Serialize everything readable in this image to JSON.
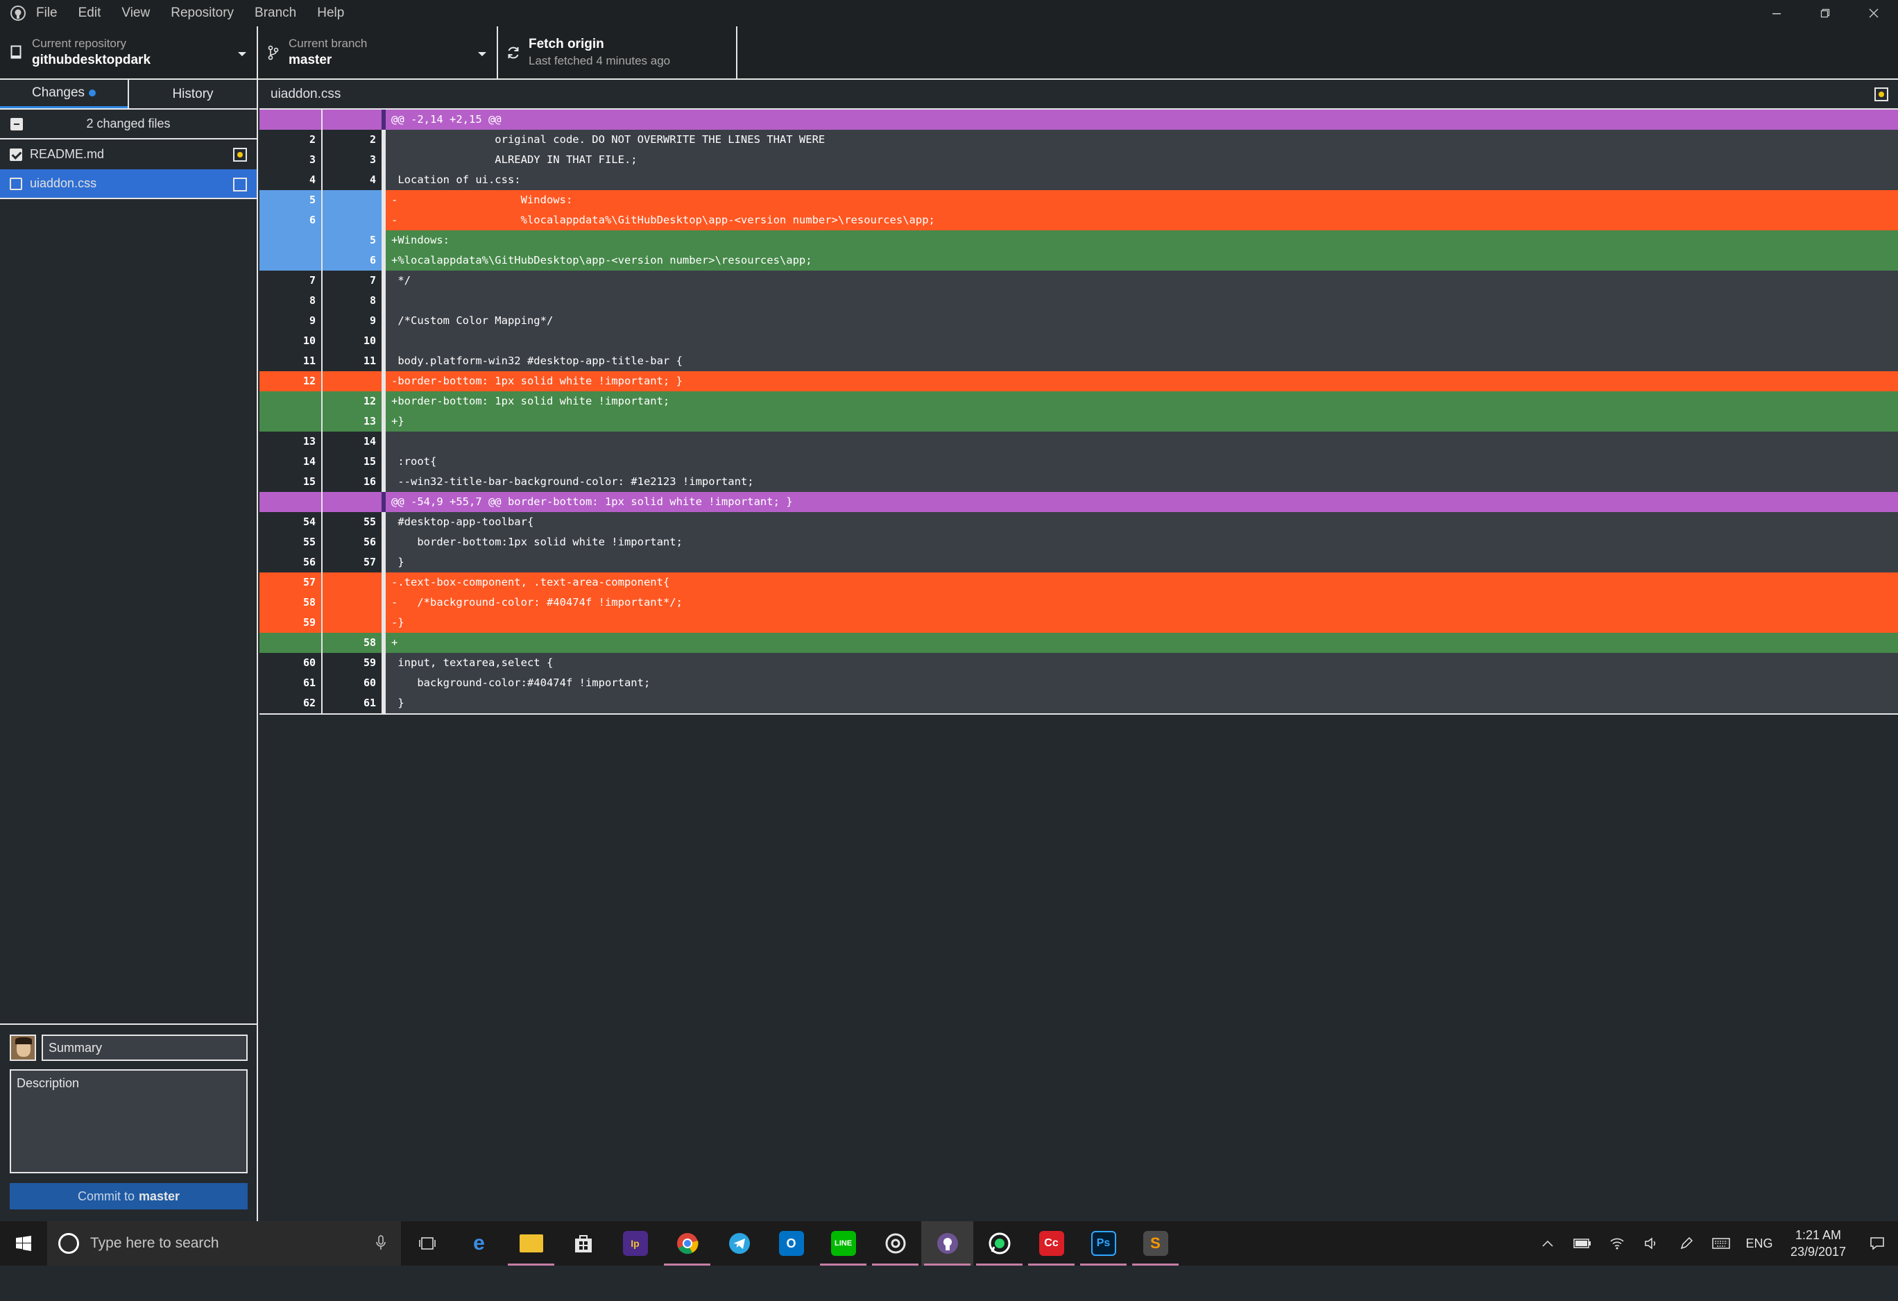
{
  "menubar": {
    "items": [
      "File",
      "Edit",
      "View",
      "Repository",
      "Branch",
      "Help"
    ]
  },
  "toolbar": {
    "repo_label": "Current repository",
    "repo_value": "githubdesktopdark",
    "branch_label": "Current branch",
    "branch_value": "master",
    "fetch_label": "Fetch origin",
    "fetch_sub": "Last fetched 4 minutes ago"
  },
  "sidebar": {
    "tab_changes": "Changes",
    "tab_history": "History",
    "changed_files": "2 changed files",
    "files": [
      {
        "name": "README.md",
        "checked": true
      },
      {
        "name": "uiaddon.css",
        "checked": false
      }
    ]
  },
  "commit": {
    "summary_placeholder": "Summary",
    "description_placeholder": "Description",
    "button_prefix": "Commit to",
    "button_branch": "master"
  },
  "diff": {
    "file_name": "uiaddon.css",
    "lines": [
      {
        "type": "hunk",
        "old": "",
        "new": "",
        "code": "@@ -2,14 +2,15 @@"
      },
      {
        "type": "ctx",
        "old": "2",
        "new": "2",
        "code": "                original code. DO NOT OVERWRITE THE LINES THAT WERE"
      },
      {
        "type": "ctx",
        "old": "3",
        "new": "3",
        "code": "                ALREADY IN THAT FILE.;"
      },
      {
        "type": "ctx",
        "old": "4",
        "new": "4",
        "code": " Location of ui.css:"
      },
      {
        "type": "sel-del",
        "old": "5",
        "new": "",
        "code": "-                   Windows:"
      },
      {
        "type": "sel-del",
        "old": "6",
        "new": "",
        "code": "-                   %localappdata%\\GitHubDesktop\\app-<version number>\\resources\\app;"
      },
      {
        "type": "sel-add",
        "old": "",
        "new": "5",
        "code": "+Windows:"
      },
      {
        "type": "sel-add",
        "old": "",
        "new": "6",
        "code": "+%localappdata%\\GitHubDesktop\\app-<version number>\\resources\\app;"
      },
      {
        "type": "ctx",
        "old": "7",
        "new": "7",
        "code": " */"
      },
      {
        "type": "ctx",
        "old": "8",
        "new": "8",
        "code": ""
      },
      {
        "type": "ctx",
        "old": "9",
        "new": "9",
        "code": " /*Custom Color Mapping*/"
      },
      {
        "type": "ctx",
        "old": "10",
        "new": "10",
        "code": ""
      },
      {
        "type": "ctx",
        "old": "11",
        "new": "11",
        "code": " body.platform-win32 #desktop-app-title-bar {"
      },
      {
        "type": "del",
        "old": "12",
        "new": "",
        "code": "-border-bottom: 1px solid white !important; }"
      },
      {
        "type": "add",
        "old": "",
        "new": "12",
        "code": "+border-bottom: 1px solid white !important;"
      },
      {
        "type": "add",
        "old": "",
        "new": "13",
        "code": "+}"
      },
      {
        "type": "ctx",
        "old": "13",
        "new": "14",
        "code": ""
      },
      {
        "type": "ctx",
        "old": "14",
        "new": "15",
        "code": " :root{"
      },
      {
        "type": "ctx",
        "old": "15",
        "new": "16",
        "code": " --win32-title-bar-background-color: #1e2123 !important;"
      },
      {
        "type": "hunk",
        "old": "",
        "new": "",
        "code": "@@ -54,9 +55,7 @@ border-bottom: 1px solid white !important; }"
      },
      {
        "type": "ctx",
        "old": "54",
        "new": "55",
        "code": " #desktop-app-toolbar{"
      },
      {
        "type": "ctx",
        "old": "55",
        "new": "56",
        "code": "    border-bottom:1px solid white !important;"
      },
      {
        "type": "ctx",
        "old": "56",
        "new": "57",
        "code": " }"
      },
      {
        "type": "del",
        "old": "57",
        "new": "",
        "code": "-.text-box-component, .text-area-component{"
      },
      {
        "type": "del",
        "old": "58",
        "new": "",
        "code": "-   /*background-color: #40474f !important*/;"
      },
      {
        "type": "del",
        "old": "59",
        "new": "",
        "code": "-}"
      },
      {
        "type": "add",
        "old": "",
        "new": "58",
        "code": "+"
      },
      {
        "type": "ctx",
        "old": "60",
        "new": "59",
        "code": " input, textarea,select {"
      },
      {
        "type": "ctx",
        "old": "61",
        "new": "60",
        "code": "    background-color:#40474f !important;"
      },
      {
        "type": "ctx",
        "old": "62",
        "new": "61",
        "code": " }"
      }
    ]
  },
  "taskbar": {
    "search_placeholder": "Type here to search",
    "apps": [
      "task-view",
      "edge",
      "file-explorer",
      "store",
      "app-purple",
      "chrome",
      "telegram",
      "outlook",
      "line",
      "camera-app",
      "github-desktop",
      "whatsapp",
      "creative-cloud",
      "photoshop",
      "sublime-text"
    ],
    "tray_lang": "ENG",
    "time": "1:21 AM",
    "date": "23/9/2017"
  },
  "colors": {
    "background": "#24292e",
    "bar": "#1e2123",
    "deleted": "#fe5722",
    "added": "#46894a",
    "hunk": "#b65fc9",
    "selected": "#2f6fd3"
  }
}
